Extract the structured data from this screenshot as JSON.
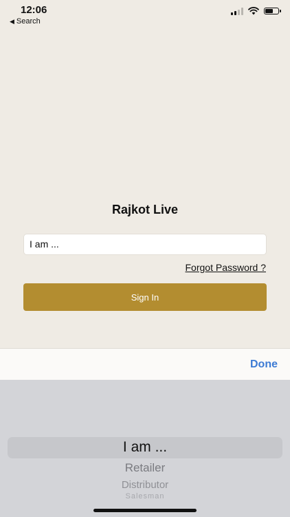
{
  "status_bar": {
    "time": "12:06",
    "back_label": "Search",
    "back_icon": "back-triangle-icon",
    "icons": [
      "cellular-signal-icon",
      "wifi-icon",
      "battery-icon"
    ],
    "battery_level": 0.55
  },
  "login": {
    "title": "Rajkot Live",
    "role_field_value": "I am ...",
    "forgot_password_label": "Forgot Password ?",
    "sign_in_label": "Sign In"
  },
  "picker": {
    "done_label": "Done",
    "options": [
      "I am ...",
      "Retailer",
      "Distributor",
      "Salesman"
    ],
    "selected_option": "I am ..."
  },
  "colors": {
    "background": "#efebe4",
    "accent": "#b38d30",
    "done_blue": "#3d7bd4",
    "picker_bg": "#d3d4d8"
  }
}
